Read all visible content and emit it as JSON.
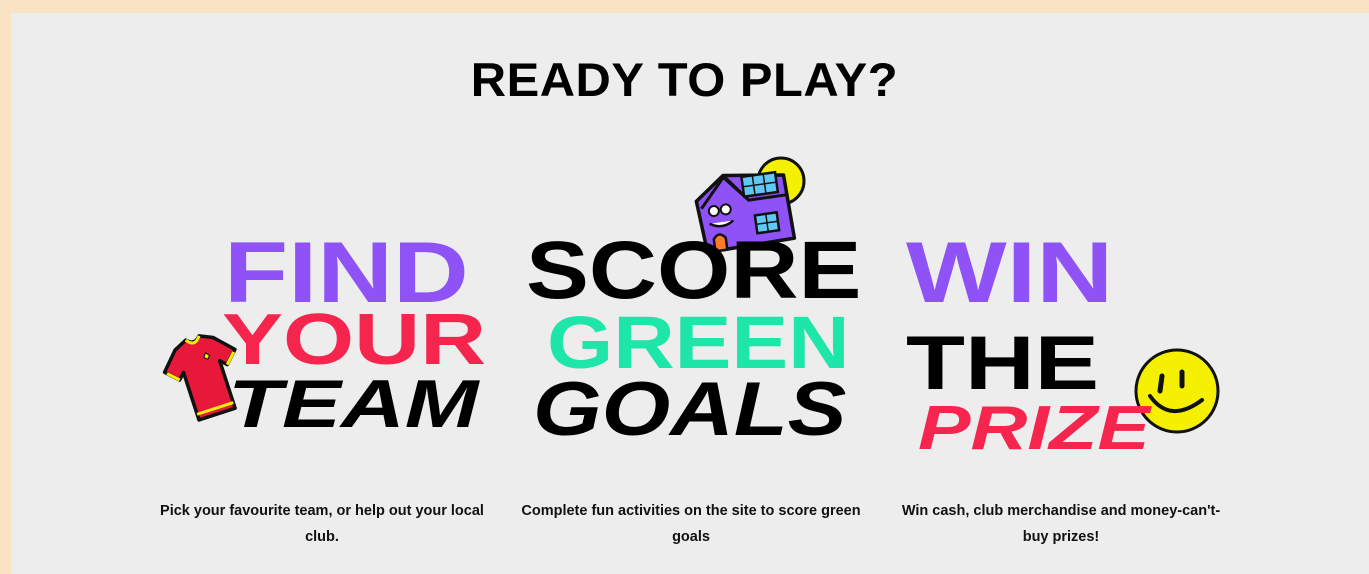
{
  "heading": "READY TO PLAY?",
  "colors": {
    "purple": "#8f52f7",
    "red": "#f5254d",
    "green": "#1de6a8",
    "black": "#000000",
    "yellow": "#f5f000"
  },
  "columns": [
    {
      "lines": [
        "FIND",
        "YOUR",
        "TEAM"
      ],
      "description": "Pick your favourite team, or help out your local club.",
      "icon": "football-shirt-icon"
    },
    {
      "lines": [
        "SCORE",
        "GREEN",
        "GOALS"
      ],
      "description": "Complete fun activities on the site to score green goals",
      "icon": "solar-house-icon"
    },
    {
      "lines": [
        "WIN",
        "THE",
        "PRIZE"
      ],
      "description": "Win cash, club merchandise and money-can't-buy prizes!",
      "icon": "smiley-face-icon"
    }
  ]
}
